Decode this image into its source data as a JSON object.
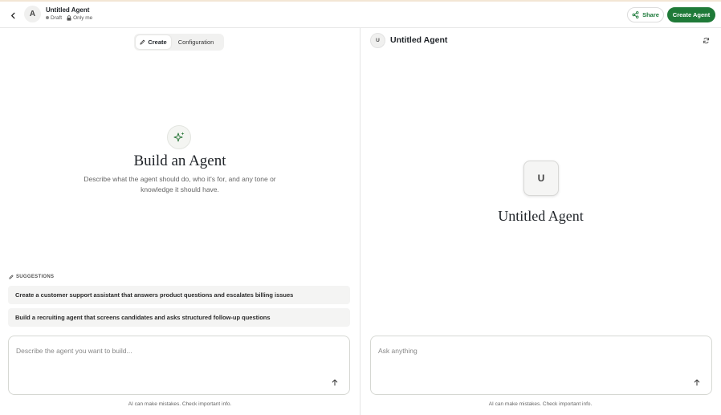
{
  "header": {
    "avatar_letter": "A",
    "title": "Untitled Agent",
    "status": "Draft",
    "visibility": "Only me",
    "share_label": "Share",
    "create_label": "Create Agent"
  },
  "builder": {
    "tabs": [
      {
        "label": "Create",
        "active": true
      },
      {
        "label": "Configuration",
        "active": false
      }
    ],
    "heading": "Build an Agent",
    "description": "Describe what the agent should do, who it's for, and any tone or knowledge it should have.",
    "suggestions_label": "SUGGESTIONS",
    "suggestions": [
      "Create a customer support assistant that answers product questions and escalates billing issues",
      "Build a recruiting agent that screens candidates and asks structured follow-up questions"
    ],
    "input_placeholder": "Describe the agent you want to build...",
    "disclaimer": "AI can make mistakes. Check important info."
  },
  "preview": {
    "avatar_letter": "U",
    "title": "Untitled Agent",
    "big_avatar_letter": "U",
    "agent_name": "Untitled Agent",
    "input_placeholder": "Ask anything",
    "disclaimer": "AI can make mistakes. Check important info."
  },
  "colors": {
    "accent": "#1f7a38",
    "share_text": "#1d7a3a"
  },
  "icons": {
    "back": "chevron-left-icon",
    "lock": "lock-icon",
    "share": "share-icon",
    "tab_create": "pen-icon",
    "sparkle": "sparkles-icon",
    "suggestions": "pen-icon",
    "send": "arrow-up-icon",
    "refresh": "refresh-icon"
  }
}
